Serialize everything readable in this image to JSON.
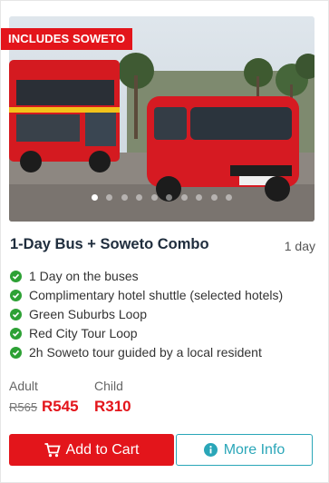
{
  "product": {
    "badge": "INCLUDES SOWETO",
    "title": "1-Day Bus + Soweto Combo",
    "duration": "1 day",
    "carousel": {
      "total": 10,
      "active_index": 0
    }
  },
  "features": [
    "1 Day on the buses",
    "Complimentary hotel shuttle (selected hotels)",
    "Green Suburbs Loop",
    "Red City Tour Loop",
    "2h Soweto tour guided by a local resident"
  ],
  "pricing": {
    "adult_label": "Adult",
    "child_label": "Child",
    "adult_old_price": "R565",
    "adult_price": "R545",
    "child_price": "R310"
  },
  "actions": {
    "cart_label": "Add to Cart",
    "info_label": "More Info"
  },
  "colors": {
    "brand_red": "#e3151b",
    "check_green": "#2da135",
    "info_teal": "#2aa6b8",
    "title_text": "#1f2d3d"
  },
  "icons": {
    "feature": "check-circle-icon",
    "cart": "cart-icon",
    "info": "info-icon"
  }
}
